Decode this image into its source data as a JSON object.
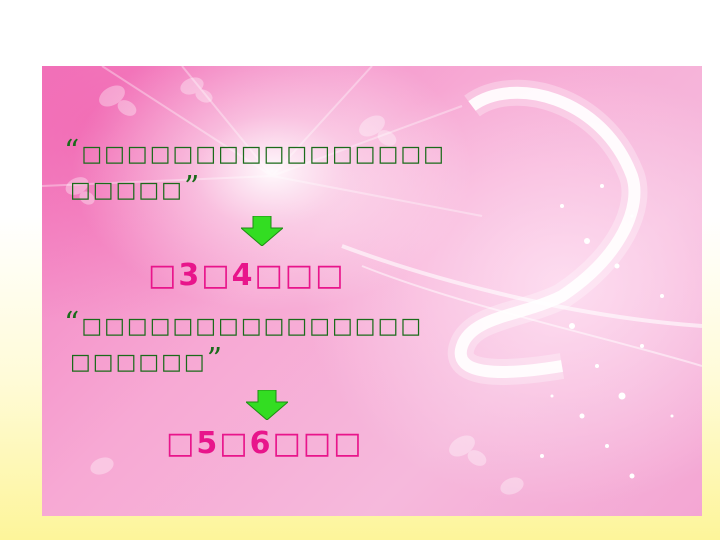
{
  "slide": {
    "prompt1": {
      "open_quote": "“",
      "line1": "□□□□□□□□□□□□□□□□",
      "line2": "□□□□□",
      "close_quote": "”"
    },
    "answer1": "□3□4□□□",
    "prompt2": {
      "open_quote": "“",
      "line1": "□□□□□□□□□□□□□□□",
      "line2": "□□□□□□",
      "close_quote": "”"
    },
    "answer2": "□5□6□□□"
  },
  "colors": {
    "text": "#1a6b1a",
    "highlight": "#e8158b",
    "arrow": "#33dd22"
  },
  "icons": {
    "arrow1": "arrow-down-icon",
    "arrow2": "arrow-down-icon"
  }
}
